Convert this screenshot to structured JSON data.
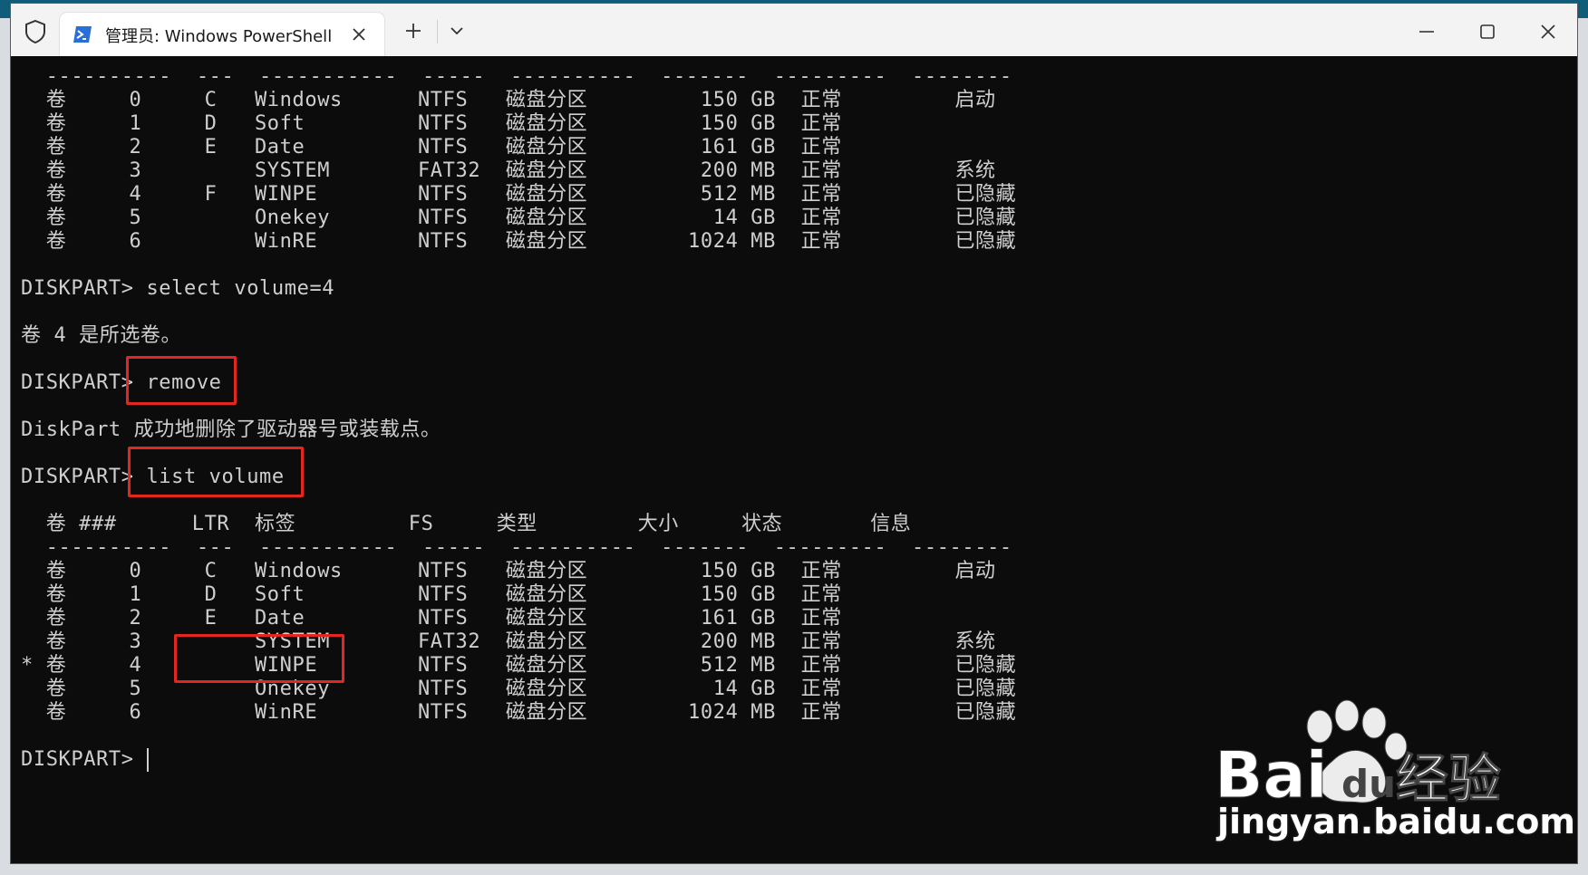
{
  "window": {
    "tab_title": "管理员: Windows PowerShell"
  },
  "icons": {
    "shield": "shield-icon",
    "powershell": "powershell-icon",
    "close_tab": "close-icon",
    "new_tab": "plus-icon",
    "dropdown": "chevron-down-icon",
    "minimize": "minimize-icon",
    "maximize": "maximize-icon",
    "close_window": "close-icon"
  },
  "colors": {
    "highlight_box": "#e3261f",
    "terminal_bg": "#0c0c0c",
    "terminal_fg": "#cccccc"
  },
  "terminal": {
    "lines": [
      "  ----------  ---  -----------  -----  ----------  -------  ---------  --------",
      "  卷     0     C   Windows      NTFS   磁盘分区         150 GB  正常         启动",
      "  卷     1     D   Soft         NTFS   磁盘分区         150 GB  正常",
      "  卷     2     E   Date         NTFS   磁盘分区         161 GB  正常",
      "  卷     3         SYSTEM       FAT32  磁盘分区         200 MB  正常         系统",
      "  卷     4     F   WINPE        NTFS   磁盘分区         512 MB  正常         已隐藏",
      "  卷     5         Onekey       NTFS   磁盘分区          14 GB  正常         已隐藏",
      "  卷     6         WinRE        NTFS   磁盘分区        1024 MB  正常         已隐藏",
      "",
      "DISKPART> select volume=4",
      "",
      "卷 4 是所选卷。",
      "",
      "DISKPART> remove",
      "",
      "DiskPart 成功地删除了驱动器号或装载点。",
      "",
      "DISKPART> list volume",
      "",
      "  卷 ###      LTR  标签         FS     类型        大小     状态       信息",
      "  ----------  ---  -----------  -----  ----------  -------  ---------  --------",
      "  卷     0     C   Windows      NTFS   磁盘分区         150 GB  正常         启动",
      "  卷     1     D   Soft         NTFS   磁盘分区         150 GB  正常",
      "  卷     2     E   Date         NTFS   磁盘分区         161 GB  正常",
      "  卷     3         SYSTEM       FAT32  磁盘分区         200 MB  正常         系统",
      "* 卷     4         WINPE        NTFS   磁盘分区         512 MB  正常         已隐藏",
      "  卷     5         Onekey       NTFS   磁盘分区          14 GB  正常         已隐藏",
      "  卷     6         WinRE        NTFS   磁盘分区        1024 MB  正常         已隐藏",
      "",
      "DISKPART> "
    ]
  },
  "watermark": {
    "brand": "Bai du 经验",
    "url": "jingyan.baidu.com"
  }
}
